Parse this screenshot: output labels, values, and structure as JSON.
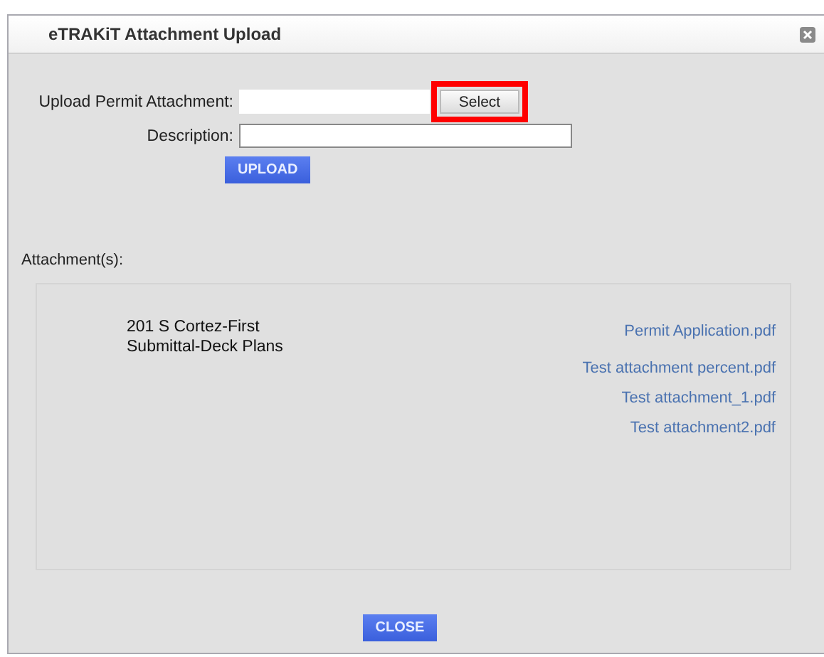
{
  "window": {
    "title": "eTRAKiT Attachment Upload"
  },
  "form": {
    "upload_label": "Upload Permit Attachment:",
    "select_button": {
      "label": "Select",
      "highlighted": true
    },
    "description_label": "Description:",
    "upload_button": "UPLOAD"
  },
  "attachments": {
    "heading": "Attachment(s):",
    "group_name": "201 S Cortez-First Submittal-Deck Plans",
    "files": [
      {
        "name": "Permit Application.pdf"
      },
      {
        "name": "Test attachment percent.pdf"
      },
      {
        "name": "Test attachment_1.pdf"
      },
      {
        "name": "Test attachment2.pdf"
      }
    ]
  },
  "close_button": "CLOSE"
}
